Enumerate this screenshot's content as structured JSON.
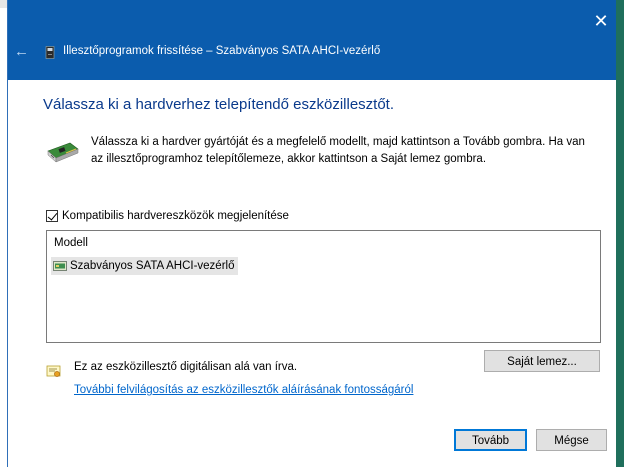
{
  "window": {
    "wizard_title": "Illesztőprogramok frissítése – Szabványos SATA AHCI-vezérlő",
    "close_glyph": "✕",
    "back_glyph": "←"
  },
  "page": {
    "heading": "Válassza ki a hardverhez telepítendő eszközillesztőt.",
    "description": "Válassza ki a hardver gyártóját és a megfelelő modellt, majd kattintson a Tovább gombra. Ha van az illesztőprogramhoz telepítőlemeze, akkor kattintson a Saját lemez gombra."
  },
  "compat_checkbox": {
    "label": "Kompatibilis hardvereszközök megjelenítése",
    "checked": true
  },
  "model_list": {
    "header": "Modell",
    "items": [
      {
        "label": "Szabványos SATA AHCI-vezérlő",
        "selected": true
      }
    ]
  },
  "signature": {
    "text": "Ez az eszközillesztő digitálisan alá van írva.",
    "link": "További felvilágosítás az eszközillesztők aláírásának fontosságáról"
  },
  "buttons": {
    "have_disk": "Saját lemez...",
    "next": "Tovább",
    "cancel": "Mégse"
  },
  "colors": {
    "titlebar": "#0b5cad",
    "heading": "#0a3a8c",
    "link": "#0066cc",
    "default_button_border": "#0078d7"
  },
  "icons": [
    "back-arrow-icon",
    "wizard-device-icon",
    "close-icon",
    "hardware-card-icon",
    "checkbox-check-icon",
    "controller-icon",
    "signature-certificate-icon"
  ]
}
